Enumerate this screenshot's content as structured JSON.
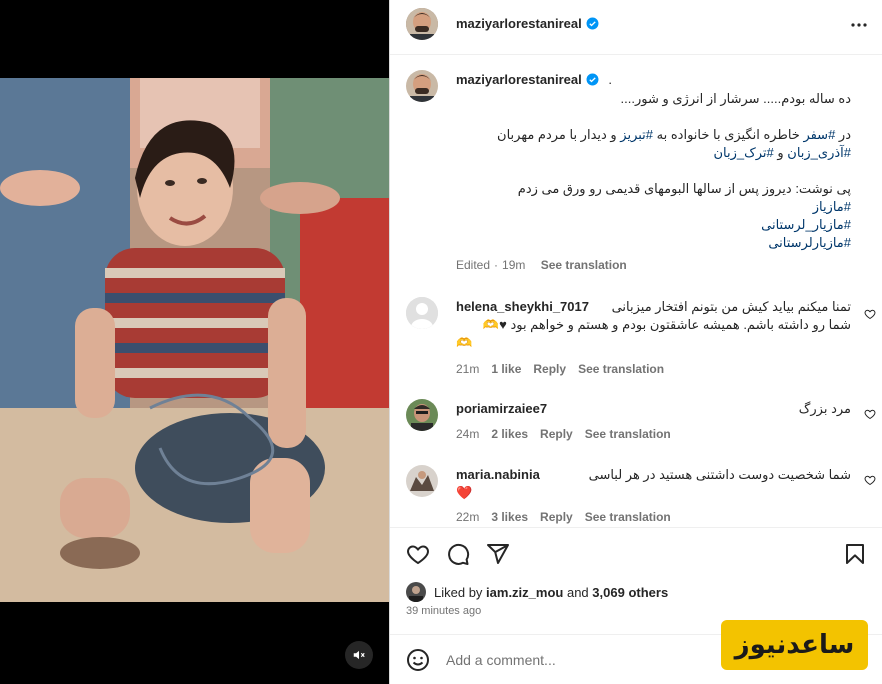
{
  "post": {
    "username": "maziyarlorestanireal",
    "caption_dot": ".",
    "caption_lines": [
      {
        "parts": [
          {
            "t": "ده ساله بودم..... سرشار از انرژی و شور....",
            "tag": false
          }
        ]
      },
      {
        "parts": [
          {
            "t": "",
            "tag": false
          }
        ]
      },
      {
        "parts": [
          {
            "t": "در ",
            "tag": false
          },
          {
            "t": "#سفر",
            "tag": true
          },
          {
            "t": " خاطره انگیزی با خانواده به ",
            "tag": false
          },
          {
            "t": "#تبریز",
            "tag": true
          },
          {
            "t": " و دیدار با مردم مهربان",
            "tag": false
          }
        ]
      },
      {
        "parts": [
          {
            "t": "#آذری_زبان",
            "tag": true
          },
          {
            "t": " و ",
            "tag": false
          },
          {
            "t": "#ترک_زبان",
            "tag": true
          }
        ]
      },
      {
        "parts": [
          {
            "t": "",
            "tag": false
          }
        ]
      },
      {
        "parts": [
          {
            "t": "پی نوشت: دیروز پس از سالها البومهای قدیمی رو ورق می زدم",
            "tag": false
          }
        ]
      },
      {
        "parts": [
          {
            "t": "#مازیاز",
            "tag": true
          }
        ]
      },
      {
        "parts": [
          {
            "t": "#مازیار_لرستانی",
            "tag": true
          }
        ]
      },
      {
        "parts": [
          {
            "t": "#مازیارلرستانی",
            "tag": true
          }
        ]
      }
    ],
    "edited": "Edited",
    "time": "19m",
    "see_translation": "See translation"
  },
  "comments": [
    {
      "username": "helena_sheykhi_7017",
      "text_lines": [
        "تمنا میکنم بیاید کیش من بتونم افتخار میزبانی",
        "شما رو داشته باشم. همیشه عاشقتون بودم و هستم و خواهم بود ♥🫶",
        "🫶"
      ],
      "time": "21m",
      "likes": "1 like",
      "reply": "Reply",
      "see_translation": "See translation",
      "avatar": "default-avatar"
    },
    {
      "username": "poriamirzaiee7",
      "text_lines": [
        "مرد بزرگ"
      ],
      "time": "24m",
      "likes": "2 likes",
      "reply": "Reply",
      "see_translation": "See translation",
      "avatar": "photo-avatar"
    },
    {
      "username": "maria.nabinia",
      "text_lines": [
        "شما شخصیت دوست داشتنی هستید در هر لباسی",
        "❤️"
      ],
      "time": "22m",
      "likes": "3 likes",
      "reply": "Reply",
      "see_translation": "See translation",
      "avatar": "photo-avatar"
    }
  ],
  "likes": {
    "prefix": "Liked by",
    "user": "iam.ziz_mou",
    "and": "and",
    "others": "3,069 others"
  },
  "posted_ago": "39 minutes ago",
  "add_comment_placeholder": "Add a comment...",
  "watermark": "ساعدنیوز",
  "icons": [
    "more-icon",
    "verified-icon",
    "heart-icon",
    "comment-icon",
    "share-icon",
    "save-icon",
    "emoji-icon",
    "mute-icon"
  ],
  "colors": {
    "link": "#00376b",
    "verified": "#0095f6",
    "secondary_text": "#737373",
    "like_red": "#ed4956",
    "watermark_bg": "#f3c300"
  }
}
